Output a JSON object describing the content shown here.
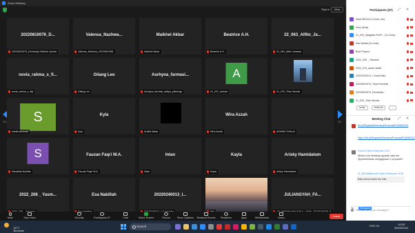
{
  "window": {
    "title": "Zoom Meeting",
    "min": "—",
    "max": "☐",
    "close": "✕"
  },
  "header": {
    "sign_in": "Sign In",
    "view": "View"
  },
  "pager": {
    "left": "1/3",
    "right": "1/3"
  },
  "tiles": [
    {
      "name": "20220810076_D...",
      "caption": "20220810076_Demindya Widhah Qonita"
    },
    {
      "name": "Valensa_Nazhwa...",
      "caption": "Valensa_Nazhwa_20220810081"
    },
    {
      "name": "Maikhel Akbar",
      "caption": "Maikhel Akbar"
    },
    {
      "name": "Beatrice A.H.",
      "caption": "Beatrice A.H."
    },
    {
      "name": "22_063_Alfito_Ja...",
      "caption": "22_063_Alfito Jaraana"
    },
    {
      "name": "novia_rahma_s_fi...",
      "caption": "novia_rahma_s_fiqi"
    },
    {
      "name": "Gilang Leo",
      "caption": "Gilang Leo"
    },
    {
      "name": "Aurhyna_farmasi...",
      "caption": "Aurhyna_farmasi_aditya_psikologi"
    },
    {
      "name": "",
      "caption": "21_047_Aninda",
      "avatar": "A"
    },
    {
      "name": "",
      "caption": "21_033_Trias Hendar"
    },
    {
      "name": "",
      "caption": "sheila fachrada",
      "avatar": "S"
    },
    {
      "name": "Kyla",
      "caption": "Kyla"
    },
    {
      "name": "",
      "caption": "Ardilla Marta"
    },
    {
      "name": "Wira Azzah",
      "caption": "Wira Azzah"
    },
    {
      "name": "",
      "caption": "ADINDA THALIA"
    },
    {
      "name": "",
      "caption": "Salsabila Nurfatin",
      "avatar": "S"
    },
    {
      "name": "Fauzan Faqri W.A.",
      "caption": "Fauzan Faqri W.A."
    },
    {
      "name": "Intan",
      "caption": "Intan"
    },
    {
      "name": "Kayla",
      "caption": "Kayla"
    },
    {
      "name": "Arisky Hamidatum",
      "caption": "Arisky Hamidatum"
    },
    {
      "name": "2022_208 _ Yasm...",
      "caption": "2022_208 _ Yasmine"
    },
    {
      "name": "Esa Nabillah",
      "caption": "Esa Nabillah"
    },
    {
      "name": "20220240013_I...",
      "caption": "20220240013_I Gusti Arika"
    },
    {
      "name": "",
      "caption": "Ilmi"
    },
    {
      "name": "JULIANSYAH_FA...",
      "caption": "JULIANSYAH FAQCHUL LISAN_20220240028_FTHI"
    }
  ],
  "toolbar": {
    "mute": "Mute",
    "stop_video": "Stop Video",
    "security": "Security",
    "participants": "Participants",
    "participants_count": "57",
    "chat": "Chat",
    "share": "Share Screen",
    "record": "Record",
    "captions": "Show Captions",
    "breakout": "Breakout Rooms",
    "reactions": "Reactions",
    "apps": "Apps",
    "whiteboards": "Whiteboards",
    "notes": "Notes",
    "end": "Leave"
  },
  "participants_panel": {
    "title": "Participants (57)",
    "list": [
      {
        "name": "Ilham BKKA (Co-host, me)",
        "color": "#7a4fd8"
      },
      {
        "name": "Hery (Host)",
        "color": "#2fa54a"
      },
      {
        "name": "21_044_Syagatta FAJR... (Co-host)",
        "color": "#2d8cff"
      },
      {
        "name": "Dila Narlita (Co-host)",
        "color": "#c0392b"
      },
      {
        "name": "Budi Priyono",
        "color": "#8e44ad"
      },
      {
        "name": "2022_208 _ Yasmine",
        "color": "#16a085"
      },
      {
        "name": "2022_224_asahi nabila",
        "color": "#d35400"
      },
      {
        "name": "20220240013_I Gusti Arika",
        "color": "#2980b9"
      },
      {
        "name": "20220810075_Tiara Pramesti",
        "color": "#c2185b"
      },
      {
        "name": "20220810076_Demindya...",
        "color": "#e67e22"
      },
      {
        "name": "21_033_Trias Hendar",
        "color": "#27ae60"
      }
    ],
    "invite": "Invite",
    "mute_all": "Mute All",
    "more": "..."
  },
  "chat": {
    "title": "Meeting Chat",
    "messages": [
      {
        "who": "",
        "text": "bit.ly/RegistrasiSeminarProposalPQMW2024",
        "link": true
      },
      {
        "who": "",
        "text": "https://bit.ly/RegistrasiSeminarProposalPQMW2024",
        "link": true
      },
      {
        "who": "From 21 Dila to Everyone 14:21",
        "text": "Mohon izin bertanya apakah satu tim @perbolehkan mengajukan 2 proposal?",
        "link": false
      },
      {
        "who": "21_060 Naffisa Aulri Gusti to Everyone 14:26",
        "text": "Baik terima kasih ibu Dila",
        "link": false
      }
    ],
    "to_label": "To:",
    "to_value": "Everyone",
    "placeholder": "Who can see your messages?"
  },
  "taskbar": {
    "temp": "32°C",
    "weather": "Berawan",
    "search": "Search",
    "tray": "ENG IN",
    "time": "14:55",
    "date": "26/03/2024"
  }
}
